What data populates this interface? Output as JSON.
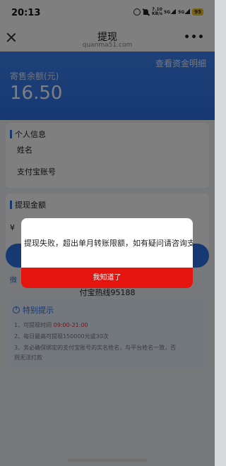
{
  "status_bar": {
    "time": "20:13",
    "net_speed_value": "7.10",
    "net_speed_unit": "KB/s",
    "signal_1": "5G",
    "signal_2": "5G",
    "battery": "95"
  },
  "nav": {
    "title": "提现",
    "url": "quanma51.com"
  },
  "hero": {
    "label": "寄售余额(元)",
    "amount": "16.50",
    "funds_link": "查看资金明细"
  },
  "personal_info": {
    "title": "个人信息",
    "name_label": "姓名",
    "alipay_label": "支付宝账号"
  },
  "withdraw": {
    "title": "提现金额",
    "currency_symbol": "¥"
  },
  "bottom": {
    "wei_link": "微",
    "hotline": "付宝热线95188"
  },
  "tips": {
    "title": "特别提示",
    "tip1_prefix": "1、可提现时间",
    "tip1_time": "09:00-21:00",
    "tip2": "2、每日最高可提现150000元或30次",
    "tip3_line1": "3、务必确保绑定的支付宝账号的实名姓名，与平台姓名一致，否",
    "tip3_line2": "则无法打款"
  },
  "dialog": {
    "message": "提现失败，超出单月转账限额，如有疑问请咨询支",
    "confirm_label": "我知道了"
  },
  "colors": {
    "brand_blue": "#2f72e6",
    "dialog_button_red": "#e3150e",
    "tip_highlight": "#e03030"
  }
}
